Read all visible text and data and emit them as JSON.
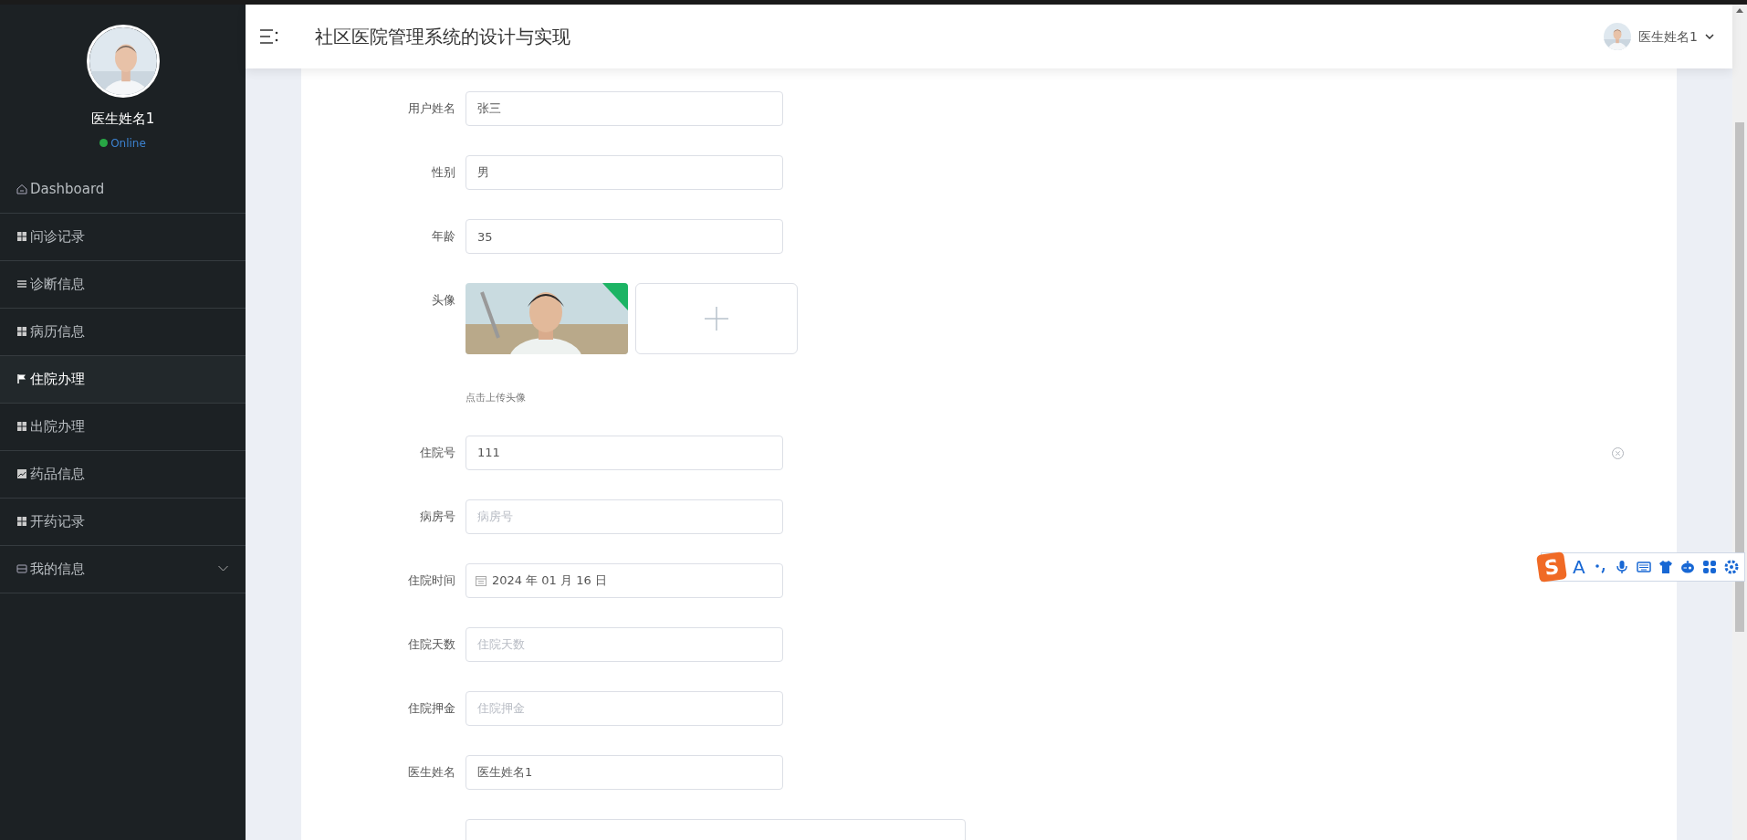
{
  "sidebar": {
    "user": {
      "name": "医生姓名1",
      "status": "Online",
      "online": true
    },
    "items": [
      {
        "label": "Dashboard",
        "kind": "link",
        "selected": false
      },
      {
        "label": "问诊记录",
        "kind": "link",
        "selected": false
      },
      {
        "label": "诊断信息",
        "kind": "link",
        "selected": false
      },
      {
        "label": "病历信息",
        "kind": "link",
        "selected": false
      },
      {
        "label": "住院办理",
        "kind": "link",
        "selected": true
      },
      {
        "label": "出院办理",
        "kind": "link",
        "selected": false
      },
      {
        "label": "药品信息",
        "kind": "link",
        "selected": false
      },
      {
        "label": "开药记录",
        "kind": "link",
        "selected": false
      },
      {
        "label": "我的信息",
        "kind": "group",
        "selected": false,
        "expanded": false
      }
    ]
  },
  "header": {
    "title": "社区医院管理系统的设计与实现",
    "user": "医生姓名1"
  },
  "form": {
    "fields": [
      {
        "kind": "text",
        "label": "用户姓名",
        "value": "张三",
        "clearable": false
      },
      {
        "kind": "text",
        "label": "性别",
        "value": "男",
        "clearable": false
      },
      {
        "kind": "text",
        "label": "年龄",
        "value": "35",
        "clearable": false
      },
      {
        "kind": "upload",
        "label": "头像",
        "hint": "点击上传头像",
        "clearable": false
      },
      {
        "kind": "text",
        "label": "住院号",
        "value": "111",
        "clearable": true
      },
      {
        "kind": "text",
        "label": "病房号",
        "placeholder": "病房号",
        "clearable": false
      },
      {
        "kind": "date",
        "label": "住院时间",
        "value": "2024 年 01 月 16 日",
        "clearable": false
      },
      {
        "kind": "text",
        "label": "住院天数",
        "placeholder": "住院天数",
        "clearable": false
      },
      {
        "kind": "text",
        "label": "住院押金",
        "placeholder": "住院押金",
        "clearable": false
      },
      {
        "kind": "text",
        "label": "医生姓名",
        "value": "医生姓名1",
        "clearable": false
      },
      {
        "kind": "textarea",
        "clearable": false
      }
    ]
  },
  "ime_toolbar": {
    "logo": "S",
    "letter": "A"
  }
}
